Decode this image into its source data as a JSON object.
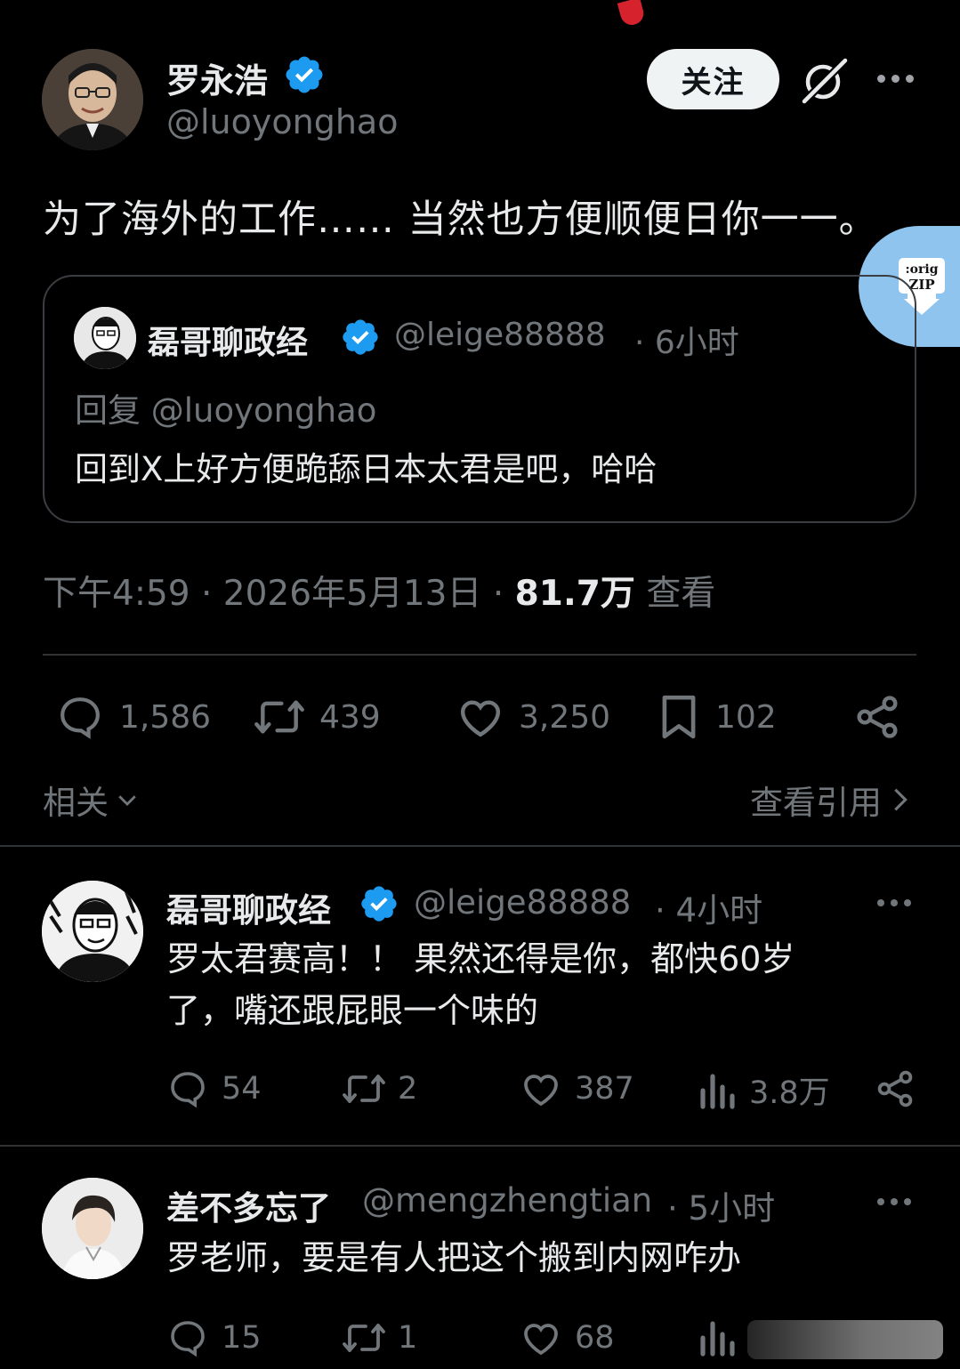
{
  "main_post": {
    "author_name": "罗永浩",
    "author_handle": "@luoyonghao",
    "follow_label": "关注",
    "text": "为了海外的工作…… 当然也方便顺便日你一一。",
    "quote": {
      "author_name": "磊哥聊政经",
      "author_handle": "@leige88888",
      "time": "· 6小时",
      "reply_to": "回复 @luoyonghao",
      "text": "回到X上好方便跪舔日本太君是吧，哈哈"
    },
    "meta": {
      "time": "下午4:59 · 2026年5月13日 ·",
      "views": "81.7万",
      "views_label": "查看"
    },
    "actions": {
      "replies": "1,586",
      "reposts": "439",
      "likes": "3,250",
      "bookmarks": "102"
    },
    "related_label": "相关",
    "view_quotes_label": "查看引用"
  },
  "zip_badge": {
    "line1": ":orig",
    "line2": "ZIP"
  },
  "replies": [
    {
      "author_name": "磊哥聊政经",
      "author_handle": "@leige88888",
      "time": "· 4小时",
      "text_line1": "罗太君赛高！！ 果然还得是你，都快60岁",
      "text_line2": "了，嘴还跟屁眼一个味的",
      "replies": "54",
      "reposts": "2",
      "likes": "387",
      "views": "3.8万"
    },
    {
      "author_name": "差不多忘了",
      "author_handle": "@mengzhengtian",
      "time": "· 5小时",
      "text_line1": "罗老师，要是有人把这个搬到内网咋办",
      "replies": "15",
      "reposts": "1",
      "likes": "68",
      "views": ""
    }
  ],
  "colors": {
    "background": "#000000",
    "text": "#e7e9ea",
    "secondary_text": "#71767b",
    "verified": "#1d9bf0",
    "divider": "#2f3336",
    "follow_button_bg": "#eff3f4",
    "zip_badge": "#8ec4ee"
  }
}
